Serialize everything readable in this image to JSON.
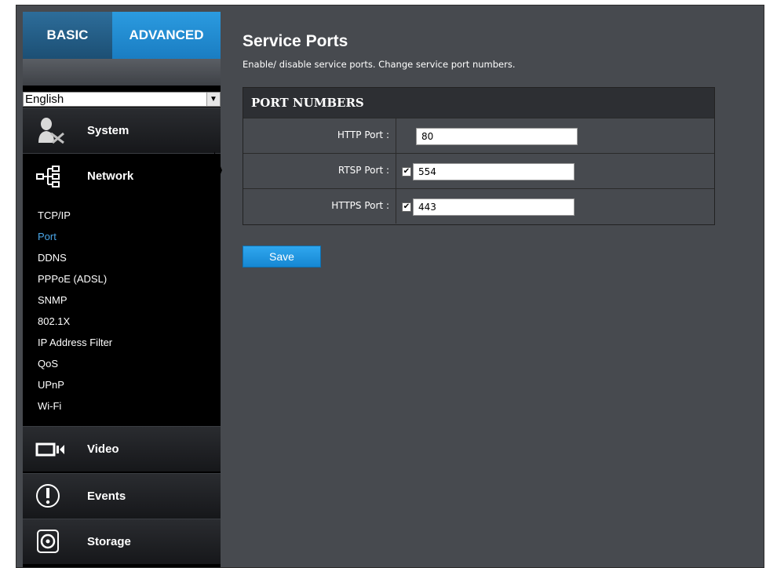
{
  "tabs": {
    "basic": "BASIC",
    "advanced": "ADVANCED"
  },
  "language": {
    "selected": "English"
  },
  "sidebar": {
    "categories": [
      {
        "label": "System",
        "icon": "system-tools-icon"
      },
      {
        "label": "Network",
        "icon": "network-icon"
      },
      {
        "label": "Video",
        "icon": "video-camera-icon"
      },
      {
        "label": "Events",
        "icon": "alert-icon"
      },
      {
        "label": "Storage",
        "icon": "storage-disk-icon"
      }
    ],
    "network_items": [
      "TCP/IP",
      "Port",
      "DDNS",
      "PPPoE (ADSL)",
      "SNMP",
      "802.1X",
      "IP Address Filter",
      "QoS",
      "UPnP",
      "Wi-Fi"
    ],
    "selected_item": "Port"
  },
  "page": {
    "title": "Service Ports",
    "description": "Enable/ disable service ports. Change service port numbers."
  },
  "ports": {
    "header": "PORT NUMBERS",
    "http": {
      "label": "HTTP Port :",
      "value": "80"
    },
    "rtsp": {
      "label": "RTSP Port :",
      "value": "554",
      "enabled": true
    },
    "https": {
      "label": "HTTPS Port :",
      "value": "443",
      "enabled": true
    }
  },
  "actions": {
    "save": "Save"
  },
  "colors": {
    "accent": "#1a7dc2",
    "selected_text": "#4aa6e8",
    "background": "#474a4f"
  }
}
